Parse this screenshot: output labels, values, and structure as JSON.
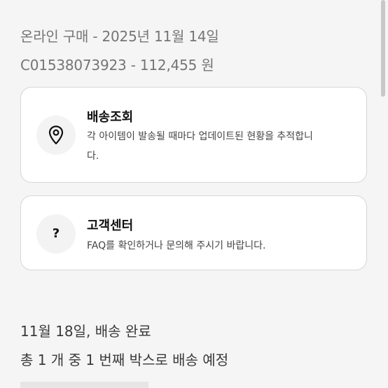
{
  "order": {
    "line1": "온라인 구매 - 2025년 11월 14일",
    "line2": "C01538073923 - 112,455 원"
  },
  "cards": {
    "tracking": {
      "icon": "location-pin-icon",
      "title": "배송조회",
      "description": "각 아이템이 발송될 때마다 업데이트된 현황을 추적합니다."
    },
    "support": {
      "icon": "question-mark-icon",
      "icon_glyph": "?",
      "title": "고객센터",
      "description": "FAQ를 확인하거나 문의해 주시기 바랍니다."
    }
  },
  "shipment": {
    "date_status": "11월 18일, 배송 완료",
    "box_info": "총 1 개 중 1 번째 박스로 배송 예정"
  },
  "colors": {
    "background": "#f5f5f5",
    "card_background": "#ffffff",
    "card_border": "#d6d6d6",
    "muted_text": "#757575"
  }
}
